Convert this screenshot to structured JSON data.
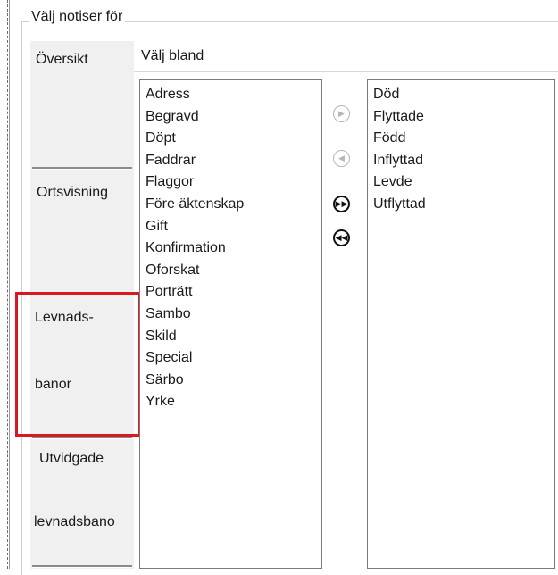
{
  "group_title": "Välj notiser för",
  "nav": {
    "items": [
      {
        "id": "oversikt",
        "lines": [
          "Översikt"
        ]
      },
      {
        "id": "ortsvisning",
        "lines": [
          "Ortsvisning"
        ]
      },
      {
        "id": "levnadsbanor",
        "lines": [
          "Levnads-",
          "banor"
        ],
        "highlighted": true
      },
      {
        "id": "utvidgade",
        "lines": [
          "Utvidgade",
          "levnadsbano"
        ]
      }
    ]
  },
  "content": {
    "select_from_label": "Välj bland",
    "available": [
      "Adress",
      "Begravd",
      "Döpt",
      "Faddrar",
      "Flaggor",
      "Före äktenskap",
      "Gift",
      "Konfirmation",
      "Oforskat",
      "Porträtt",
      "Sambo",
      "Skild",
      "Special",
      "Särbo",
      "Yrke"
    ],
    "selected": [
      "Död",
      "Flyttade",
      "Född",
      "Inflyttad",
      "Levde",
      "Utflyttad"
    ],
    "buttons": {
      "add_one": {
        "glyph": "▶",
        "enabled": false
      },
      "remove_one": {
        "glyph": "◀",
        "enabled": false
      },
      "add_all": {
        "glyph": "▶▶",
        "enabled": true
      },
      "remove_all": {
        "glyph": "◀◀",
        "enabled": true
      }
    }
  },
  "colors": {
    "highlight": "#d71920",
    "nav_bg": "#f0f0f0",
    "list_border": "#7a7a7a"
  }
}
